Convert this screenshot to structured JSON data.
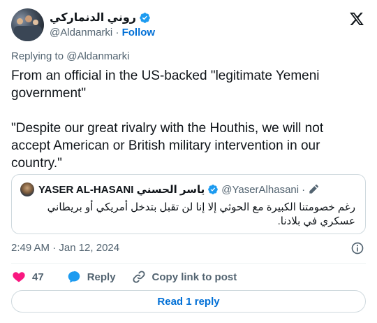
{
  "author": {
    "display_name": "روني الدنماركي",
    "handle": "@Aldanmarki",
    "separator": "·",
    "follow_label": "Follow"
  },
  "replying_to": {
    "prefix": "Replying to ",
    "mention": "@Aldanmarki"
  },
  "tweet_text": "From an official in the US-backed \"legitimate Yemeni government\"\n\n\"Despite our great rivalry with the Houthis, we will not accept American or British military intervention in our country.\"",
  "quoted_tweet": {
    "display_name": "YASER AL-HASANI ياسر الحسني",
    "handle": "@YaserAlhasani",
    "separator": "·",
    "text": "رغم خصومتنا الكبيرة مع الحوثي إلا إنا لن تقبل بتدخل أمريكي أو بريطاني عسكري في بلادنا."
  },
  "timestamp": "2:49 AM · Jan 12, 2024",
  "actions": {
    "like_count": "47",
    "reply_label": "Reply",
    "copy_link_label": "Copy link to post"
  },
  "read_replies_label": "Read 1 reply",
  "colors": {
    "accent": "#006fd6",
    "verified": "#1d9bf0",
    "like": "#f91880",
    "muted": "#536471"
  }
}
